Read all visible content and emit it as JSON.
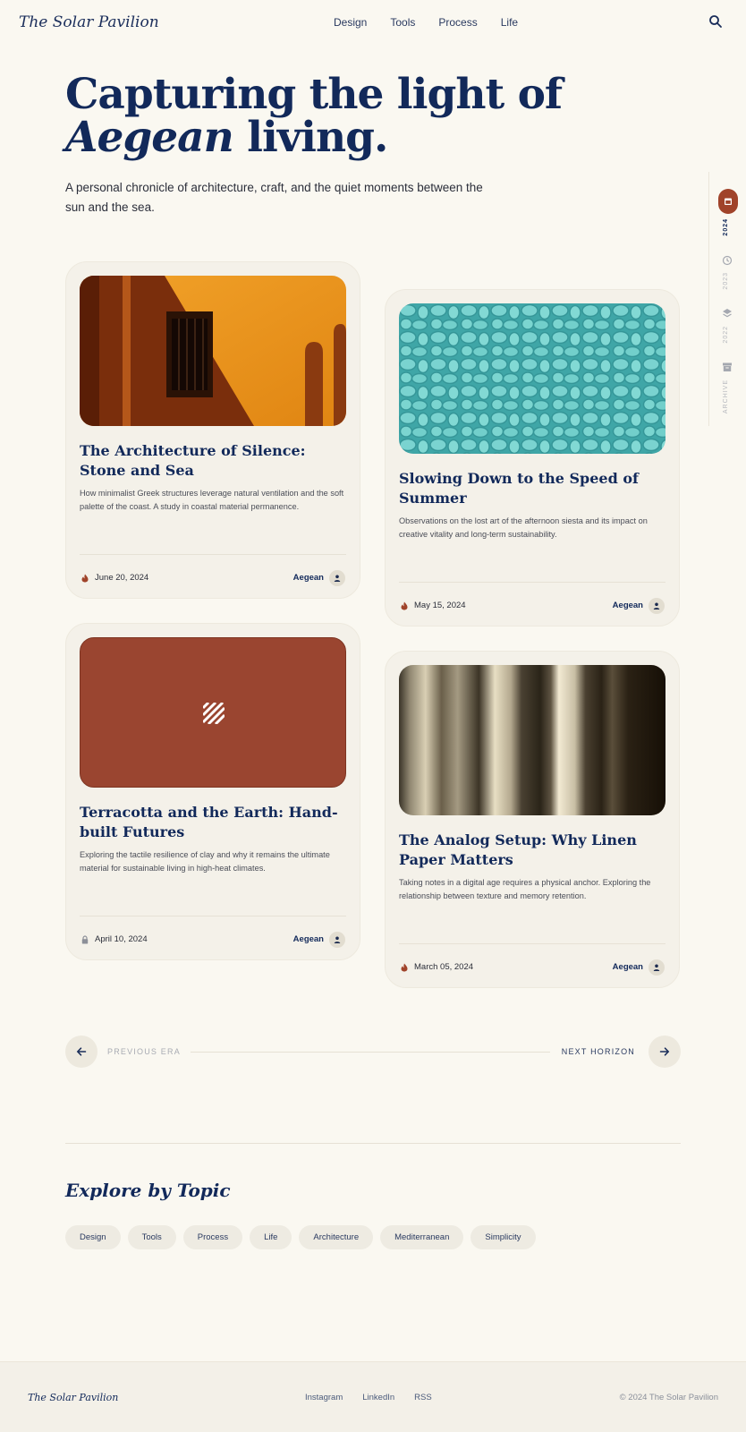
{
  "header": {
    "logo": "The Solar Pavilion",
    "nav": [
      "Design",
      "Tools",
      "Process",
      "Life"
    ]
  },
  "hero": {
    "title_line1": "Capturing the light of",
    "title_em": "Aegean",
    "title_rest": " living.",
    "subtitle": "A personal chronicle of architecture, craft, and the quiet moments between the sun and the sea."
  },
  "rail": {
    "items": [
      {
        "label": "2024",
        "icon": "calendar-icon",
        "active": true
      },
      {
        "label": "2023",
        "icon": "history-icon",
        "active": false
      },
      {
        "label": "2022",
        "icon": "layers-icon",
        "active": false
      },
      {
        "label": "ARCHIVE",
        "icon": "archive-icon",
        "active": false
      }
    ]
  },
  "cards": [
    {
      "title": "The Architecture of Silence: Stone and Sea",
      "desc": "How minimalist Greek structures leverage natural ventilation and the soft palette of the coast. A study in coastal material permanence.",
      "date": "June 20, 2024",
      "date_icon": "flame-icon",
      "author": "Aegean",
      "image": "orange-wall-window"
    },
    {
      "title": "Slowing Down to the Speed of Summer",
      "desc": "Observations on the lost art of the afternoon siesta and its impact on creative vitality and long-term sustainability.",
      "date": "May 15, 2024",
      "date_icon": "flame-icon",
      "author": "Aegean",
      "image": "turquoise-pebbles"
    },
    {
      "title": "Terracotta and the Earth: Hand-built Futures",
      "desc": "Exploring the tactile resilience of clay and why it remains the ultimate material for sustainable living in high-heat climates.",
      "date": "April 10, 2024",
      "date_icon": "lock-icon",
      "author": "Aegean",
      "image": "terracotta-placeholder"
    },
    {
      "title": "The Analog Setup: Why Linen Paper Matters",
      "desc": "Taking notes in a digital age requires a physical anchor. Exploring the relationship between texture and memory retention.",
      "date": "March 05, 2024",
      "date_icon": "flame-icon",
      "author": "Aegean",
      "image": "linen-curtains"
    }
  ],
  "pagination": {
    "prev": "PREVIOUS ERA",
    "next": "NEXT HORIZON"
  },
  "topics": {
    "title": "Explore by Topic",
    "tags": [
      "Design",
      "Tools",
      "Process",
      "Life",
      "Architecture",
      "Mediterranean",
      "Simplicity"
    ]
  },
  "footer": {
    "logo": "The Solar Pavilion",
    "links": [
      "Instagram",
      "LinkedIn",
      "RSS"
    ],
    "copyright": "© 2024 The Solar Pavilion"
  },
  "colors": {
    "background": "#faf8f1",
    "navy": "#12295a",
    "terracotta": "#a0432a",
    "card": "#f4f1e9"
  }
}
